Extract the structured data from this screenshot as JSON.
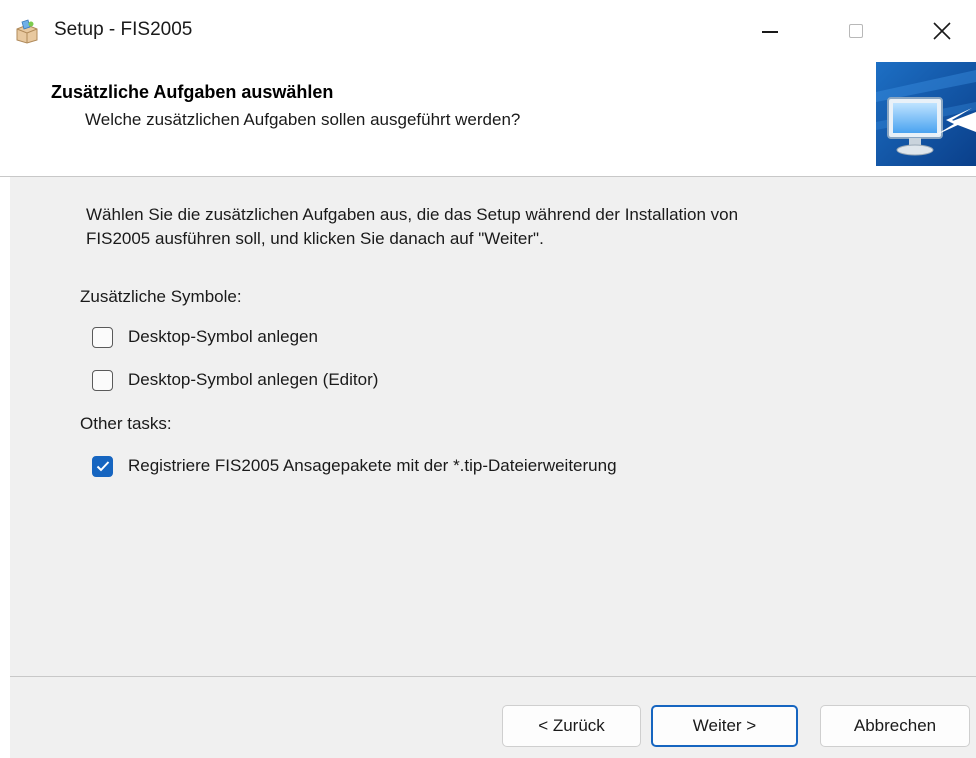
{
  "window": {
    "title": "Setup - FIS2005",
    "icon": "setup-package-icon"
  },
  "header": {
    "title": "Zusätzliche Aufgaben auswählen",
    "subtitle": "Welche zusätzlichen Aufgaben sollen ausgeführt werden?",
    "image": "monitor-arrow-icon"
  },
  "content": {
    "intro_line1": "Wählen Sie die zusätzlichen Aufgaben aus, die das Setup während der Installation von",
    "intro_line2": "FIS2005 ausführen soll, und klicken Sie danach auf \"Weiter\".",
    "groups": [
      {
        "label": "Zusätzliche Symbole:",
        "tasks": [
          {
            "label": "Desktop-Symbol anlegen",
            "checked": false
          },
          {
            "label": "Desktop-Symbol anlegen (Editor)",
            "checked": false
          }
        ]
      },
      {
        "label": "Other tasks:",
        "tasks": [
          {
            "label": "Registriere FIS2005 Ansagepakete mit der *.tip-Dateierweiterung",
            "checked": true
          }
        ]
      }
    ]
  },
  "buttons": {
    "back": "< Zurück",
    "next": "Weiter >",
    "cancel": "Abbrechen"
  },
  "colors": {
    "accent": "#1665c0",
    "panel": "#f0f0f0"
  }
}
